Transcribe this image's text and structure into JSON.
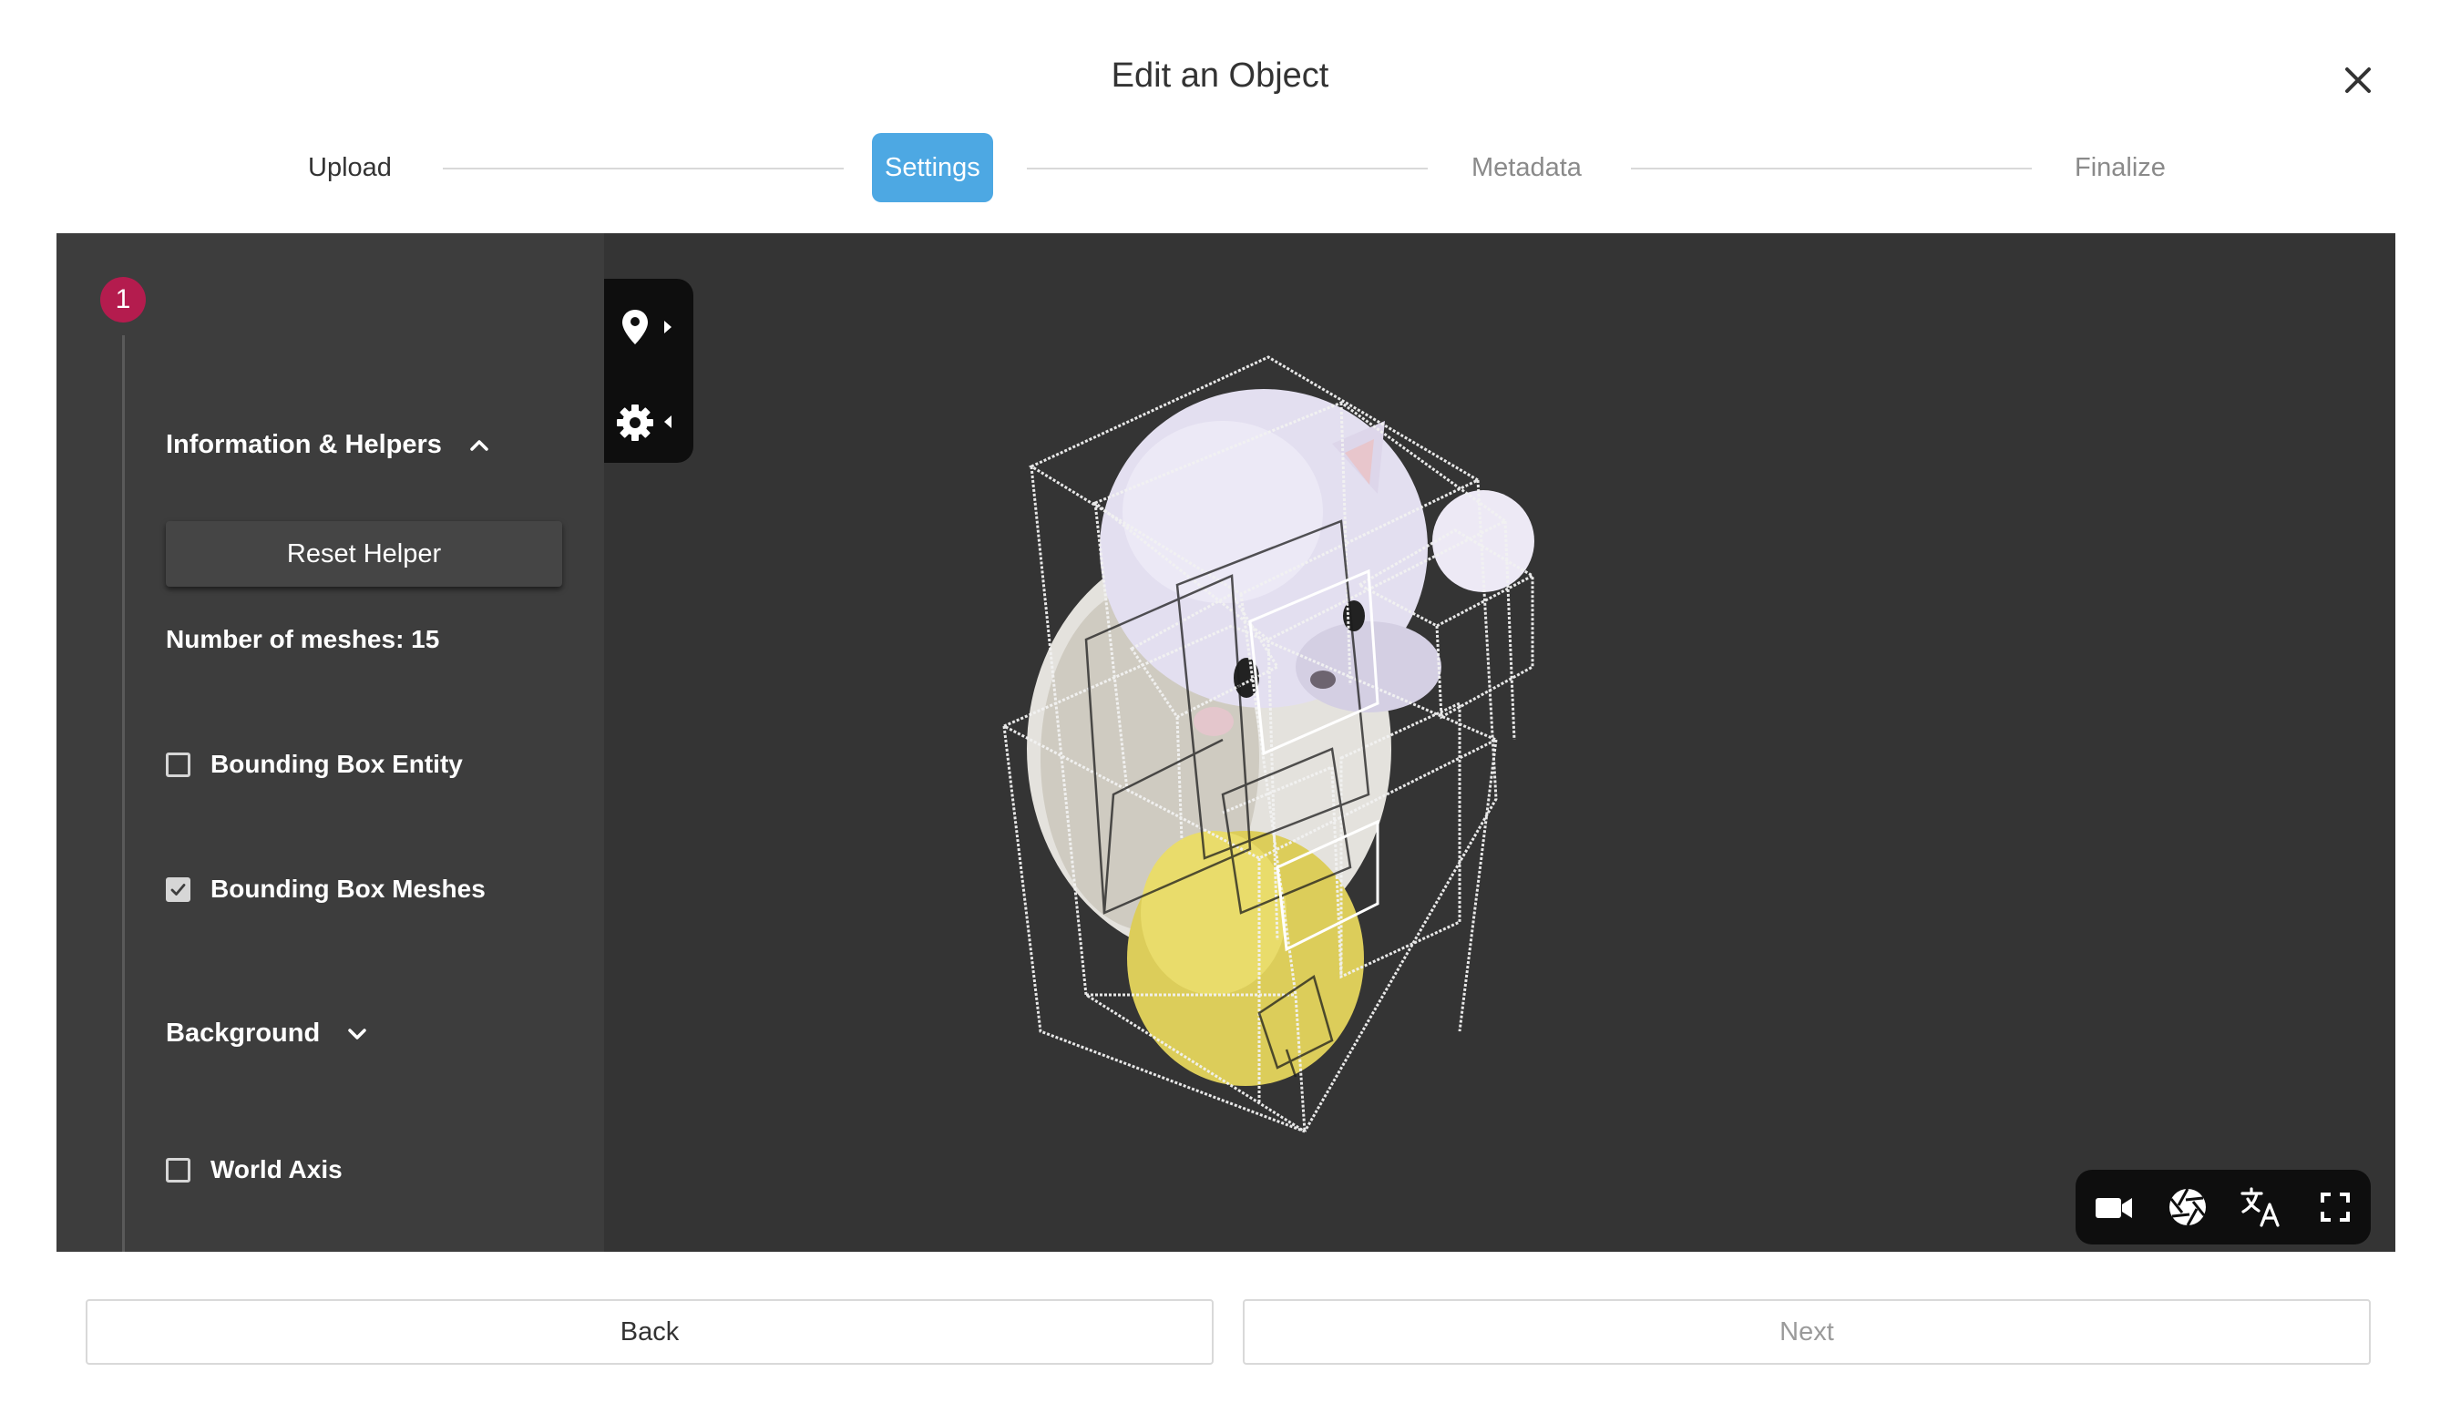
{
  "dialog": {
    "title": "Edit an Object"
  },
  "stepper": {
    "steps": [
      "Upload",
      "Settings",
      "Metadata",
      "Finalize"
    ],
    "active": "Settings"
  },
  "sidebar": {
    "step_number": "1",
    "info_section": "Information & Helpers",
    "reset_helper": "Reset Helper",
    "meshes_info": "Number of meshes: 15",
    "options": [
      {
        "label": "Bounding Box Entity",
        "checked": false
      },
      {
        "label": "Bounding Box Meshes",
        "checked": true
      }
    ],
    "background_section": "Background",
    "world_axis": {
      "label": "World Axis",
      "checked": false
    }
  },
  "viewer": {
    "left_tools": [
      "map-pin-icon",
      "gear-icon"
    ],
    "bottom_tools": [
      "video-camera-icon",
      "aperture-icon",
      "translate-icon",
      "fullscreen-icon"
    ]
  },
  "footer": {
    "back": "Back",
    "next": "Next"
  },
  "colors": {
    "accent": "#4da8e3",
    "badge": "#b41c4e",
    "panel_bg": "#343434",
    "sidebar_bg": "#3d3d3d"
  }
}
